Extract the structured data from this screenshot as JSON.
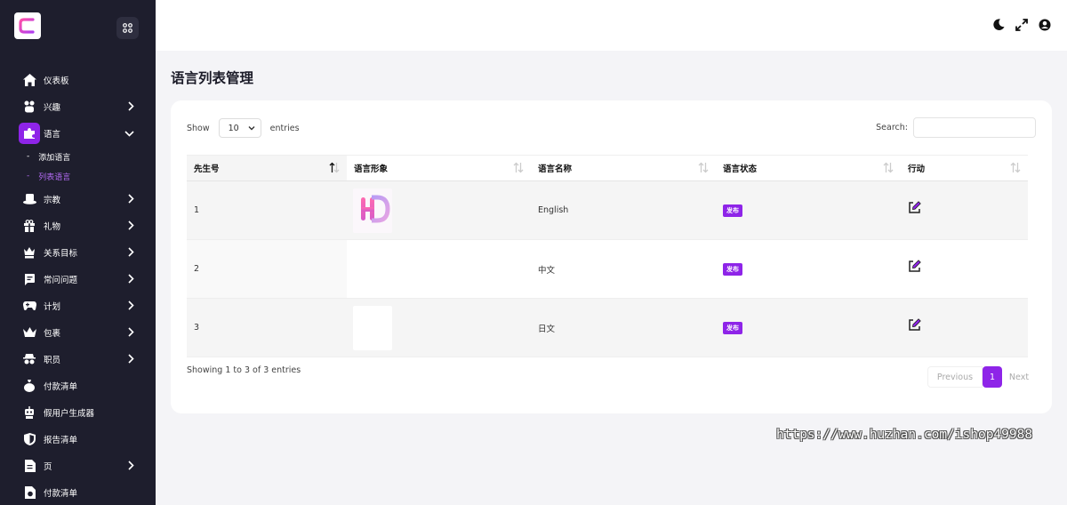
{
  "sidebar": {
    "items": [
      {
        "label": "仪表板",
        "icon": "home-icon",
        "chevron": false
      },
      {
        "label": "兴趣",
        "icon": "interests-icon",
        "chevron": true
      },
      {
        "label": "语言",
        "icon": "puzzle-icon",
        "chevron": true,
        "active": true
      },
      {
        "label": "宗教",
        "icon": "hat-icon",
        "chevron": true
      },
      {
        "label": "礼物",
        "icon": "gift-icon",
        "chevron": true
      },
      {
        "label": "关系目标",
        "icon": "crown-icon",
        "chevron": true
      },
      {
        "label": "常问问题",
        "icon": "faq-icon",
        "chevron": true
      },
      {
        "label": "计划",
        "icon": "gamepad-icon",
        "chevron": true
      },
      {
        "label": "包裹",
        "icon": "package-icon",
        "chevron": true
      },
      {
        "label": "职员",
        "icon": "staff-icon",
        "chevron": true
      },
      {
        "label": "付款清单",
        "icon": "money-bag-icon",
        "chevron": false
      },
      {
        "label": "假用户生成器",
        "icon": "robot-icon",
        "chevron": false
      },
      {
        "label": "报告清单",
        "icon": "shield-icon",
        "chevron": false
      },
      {
        "label": "页",
        "icon": "page-icon",
        "chevron": true
      },
      {
        "label": "付款清单",
        "icon": "payout-icon",
        "chevron": false
      }
    ],
    "language_sub": [
      {
        "label": "添加语言",
        "active": false
      },
      {
        "label": "列表语言",
        "active": true
      }
    ]
  },
  "page": {
    "title": "语言列表管理"
  },
  "table_controls": {
    "show_label": "Show",
    "entries_value": "10",
    "entries_label": "entries",
    "search_label": "Search:"
  },
  "table": {
    "headers": [
      "先生号",
      "语言形象",
      "语言名称",
      "语言状态",
      "行动"
    ],
    "rows": [
      {
        "no": "1",
        "image": "hd-logo",
        "name": "English",
        "status": "发布"
      },
      {
        "no": "2",
        "image": "none",
        "name": "中文",
        "status": "发布"
      },
      {
        "no": "3",
        "image": "blank",
        "name": "日文",
        "status": "发布"
      }
    ]
  },
  "footer": {
    "info": "Showing 1 to 3 of 3 entries",
    "prev": "Previous",
    "page": "1",
    "next": "Next"
  },
  "watermark": "https://www.huzhan.com/ishop49988",
  "colors": {
    "accent": "#8e24e8",
    "sidebar_bg": "#1e1e2d",
    "page_bg": "#f4f4f7"
  }
}
